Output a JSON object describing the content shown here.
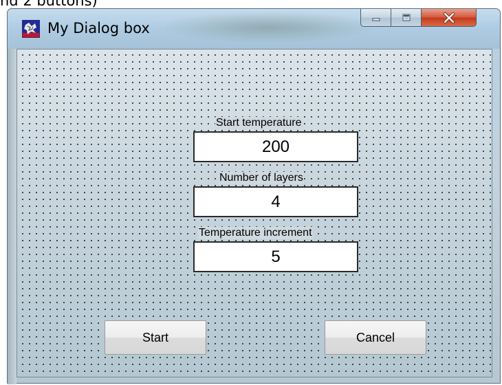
{
  "caption": "nd 2 buttons)",
  "window": {
    "title": "My Dialog box",
    "icon": "app-icon",
    "controls": {
      "minimize": "minimize-icon",
      "maximize": "maximize-icon",
      "close": "close-icon"
    }
  },
  "form": {
    "fields": [
      {
        "label": "Start temperature",
        "value": "200"
      },
      {
        "label": "Number of layers",
        "value": "4"
      },
      {
        "label": "Temperature increment",
        "value": "5"
      }
    ]
  },
  "buttons": {
    "start_label": "Start",
    "cancel_label": "Cancel"
  },
  "colors": {
    "close_button": "#c4391b",
    "title_bar": "#aecbe2",
    "dialog_background": "#c7d4dc"
  }
}
